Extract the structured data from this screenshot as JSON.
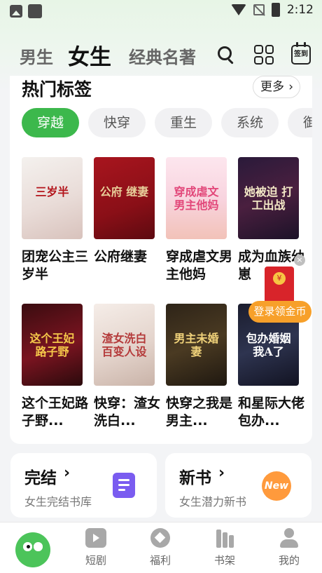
{
  "status_bar": {
    "time": "2:12"
  },
  "header": {
    "tabs": [
      {
        "label": "男生",
        "active": false
      },
      {
        "label": "女生",
        "active": true
      },
      {
        "label": "经典名著",
        "active": false
      }
    ],
    "checkin_label": "签到",
    "icons": [
      "search-icon",
      "grid-icon",
      "calendar-checkin-icon"
    ]
  },
  "hot_tags": {
    "title": "热门标签",
    "more_label": "更多",
    "chips": [
      "穿越",
      "快穿",
      "重生",
      "系统",
      "御兽"
    ],
    "active_chip": "穿越",
    "books": [
      {
        "title": "团宠公主三岁半",
        "cover_text": "三岁半",
        "cover_bg": "linear-gradient(160deg,#f4f1ee 0%,#e9dcd8 55%,#d8c2bc 100%)",
        "cover_color": "#b3141b"
      },
      {
        "title": "公府继妻",
        "cover_text": "公府 继妻",
        "cover_bg": "linear-gradient(160deg,#a8151e 0%,#8a0f17 60%,#5d0a10 100%)",
        "cover_color": "#e8cf9a"
      },
      {
        "title": "穿成虐文男主他妈",
        "cover_text": "穿成虐文 男主他妈",
        "cover_bg": "linear-gradient(180deg,#fde6ee 0%,#f8d4df 50%,#f2c2b8 100%)",
        "cover_color": "#e2477a"
      },
      {
        "title": "成为血族幼崽",
        "cover_text": "她被迫 打工出战",
        "cover_bg": "linear-gradient(160deg,#2a1a3a 0%,#4a1f3f 50%,#1c1228 100%)",
        "cover_color": "#f4e9c7"
      },
      {
        "title": "这个王妃路子野...",
        "cover_text": "这个王妃 路子野",
        "cover_bg": "linear-gradient(160deg,#3a0c10 0%,#7a1420 55%,#2a0a0c 100%)",
        "cover_color": "#f5c84a"
      },
      {
        "title": "快穿：渣女洗白...",
        "cover_text": "渣女洗白 百变人设",
        "cover_bg": "linear-gradient(160deg,#f5ede8 0%,#e4d4cc 55%,#c9b3a8 100%)",
        "cover_color": "#b43a3a"
      },
      {
        "title": "快穿之我是男主...",
        "cover_text": "男主未婚妻",
        "cover_bg": "linear-gradient(160deg,#2e2418 0%,#4a3a22 50%,#1f1810 100%)",
        "cover_color": "#f0d27a"
      },
      {
        "title": "和星际大佬包办...",
        "cover_text": "包办婚姻 我A了",
        "cover_bg": "linear-gradient(160deg,#1b1d2e 0%,#2e3450 50%,#121322 100%)",
        "cover_color": "#ffffff"
      }
    ]
  },
  "floating_reward": {
    "label": "登录领金币",
    "close_label": "×"
  },
  "bottom_cards": [
    {
      "title": "完结",
      "subtitle": "女生完结书库",
      "icon": "document-icon"
    },
    {
      "title": "新书",
      "subtitle": "女生潜力新书",
      "icon": "new-badge-icon",
      "badge": "New"
    }
  ],
  "bottom_nav": {
    "items": [
      {
        "label": "",
        "icon": "app-logo-icon"
      },
      {
        "label": "短剧",
        "icon": "tv-icon"
      },
      {
        "label": "福利",
        "icon": "gift-icon"
      },
      {
        "label": "书架",
        "icon": "bookshelf-icon"
      },
      {
        "label": "我的",
        "icon": "user-icon"
      }
    ]
  },
  "colors": {
    "accent": "#3cb84c",
    "reward": "#f7a02a",
    "purple": "#7a5cf0"
  }
}
